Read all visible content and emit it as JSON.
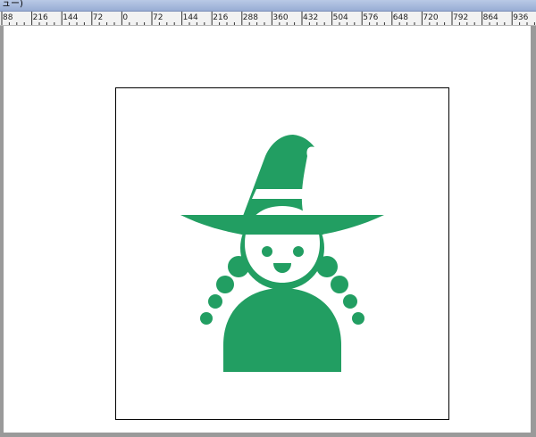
{
  "window": {
    "title_fragment": "ュー)"
  },
  "ruler": {
    "labels": [
      "88",
      "216",
      "144",
      "72",
      "0",
      "72",
      "144",
      "216",
      "288",
      "360",
      "432",
      "504",
      "576",
      "648",
      "720",
      "792",
      "864",
      "936"
    ]
  },
  "artwork": {
    "icon": "witch-pictogram",
    "fill_color": "#229e62",
    "background_color": "#ffffff",
    "border_color": "#000000"
  }
}
